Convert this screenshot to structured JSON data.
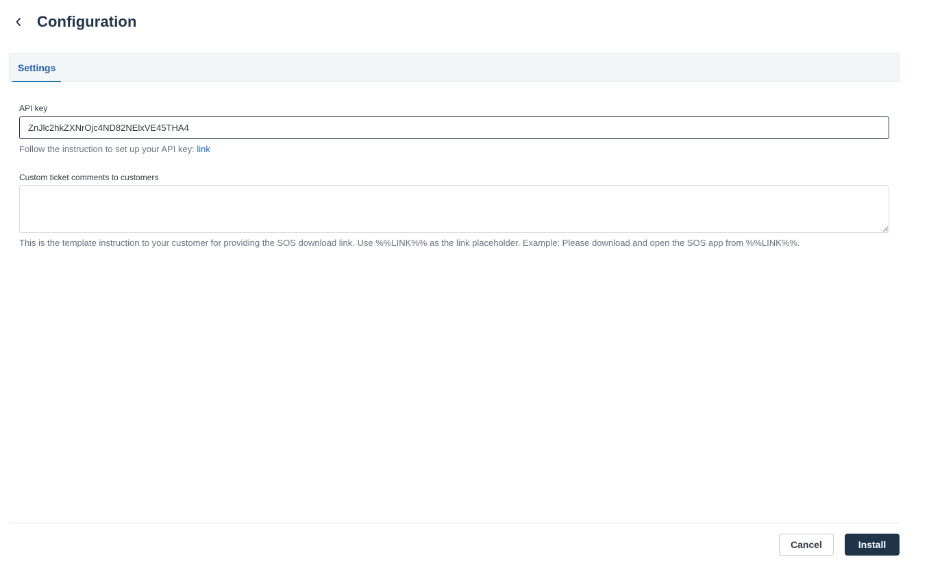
{
  "header": {
    "back_icon": "chevron-left-icon",
    "title": "Configuration"
  },
  "tabs": [
    {
      "label": "Settings",
      "active": true
    }
  ],
  "form": {
    "api_key": {
      "label": "API key",
      "value": "ZnJlc2hkZXNrOjc4ND82NElxVE45THA4",
      "hint_text": "Follow the instruction to set up your API key: ",
      "hint_link": "link"
    },
    "comments": {
      "label": "Custom ticket comments to customers",
      "value": "",
      "hint_text": "This is the template instruction to your customer for providing the SOS download link. Use %%LINK%% as the link placeholder. Example: Please download and open the SOS app from %%LINK%%."
    }
  },
  "footer": {
    "cancel_label": "Cancel",
    "install_label": "Install"
  },
  "colors": {
    "title": "#1f3449",
    "tab_active": "#1f5eae",
    "link": "#1f73b7",
    "primary_button": "#1f3449"
  }
}
